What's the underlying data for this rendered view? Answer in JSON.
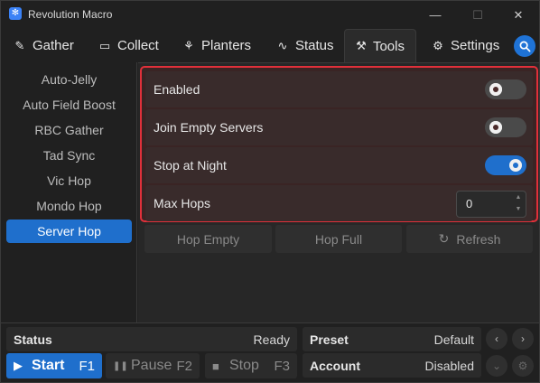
{
  "window": {
    "title": "Revolution Macro",
    "minimize": "—",
    "maximize": "☐",
    "close": "✕",
    "app_icon_glyph": "✻"
  },
  "tabs": [
    {
      "label": "Gather",
      "icon": "brush-icon",
      "glyph": "✎"
    },
    {
      "label": "Collect",
      "icon": "ticket-icon",
      "glyph": "▭"
    },
    {
      "label": "Planters",
      "icon": "plant-icon",
      "glyph": "⚘"
    },
    {
      "label": "Status",
      "icon": "pulse-icon",
      "glyph": "∿"
    },
    {
      "label": "Tools",
      "icon": "wrench-icon",
      "glyph": "⚒"
    },
    {
      "label": "Settings",
      "icon": "gear-icon",
      "glyph": "⚙"
    }
  ],
  "active_tab": "Tools",
  "sidebar": {
    "items": [
      "Auto-Jelly",
      "Auto Field Boost",
      "RBC Gather",
      "Tad Sync",
      "Vic Hop",
      "Mondo Hop",
      "Server Hop"
    ],
    "active": "Server Hop"
  },
  "settings": {
    "enabled": {
      "label": "Enabled",
      "on": false
    },
    "join_empty": {
      "label": "Join Empty Servers",
      "on": false
    },
    "stop_night": {
      "label": "Stop at Night",
      "on": true
    },
    "max_hops": {
      "label": "Max Hops",
      "value": "0"
    }
  },
  "actions": {
    "hop_empty": "Hop Empty",
    "hop_full": "Hop Full",
    "refresh": "Refresh",
    "refresh_glyph": "↻"
  },
  "bottom": {
    "status_label": "Status",
    "status_value": "Ready",
    "preset_label": "Preset",
    "preset_value": "Default",
    "account_label": "Account",
    "account_value": "Disabled",
    "start_label": "Start",
    "start_key": "F1",
    "start_glyph": "▶",
    "pause_label": "Pause",
    "pause_key": "F2",
    "pause_glyph": "❚❚",
    "stop_label": "Stop",
    "stop_key": "F3",
    "stop_glyph": "■",
    "prev_glyph": "‹",
    "next_glyph": "›",
    "dropdown_glyph": "⌄",
    "gear_glyph": "⚙"
  },
  "colors": {
    "accent": "#1f6fcc",
    "highlight_border": "#e0303a",
    "background": "#202020"
  }
}
